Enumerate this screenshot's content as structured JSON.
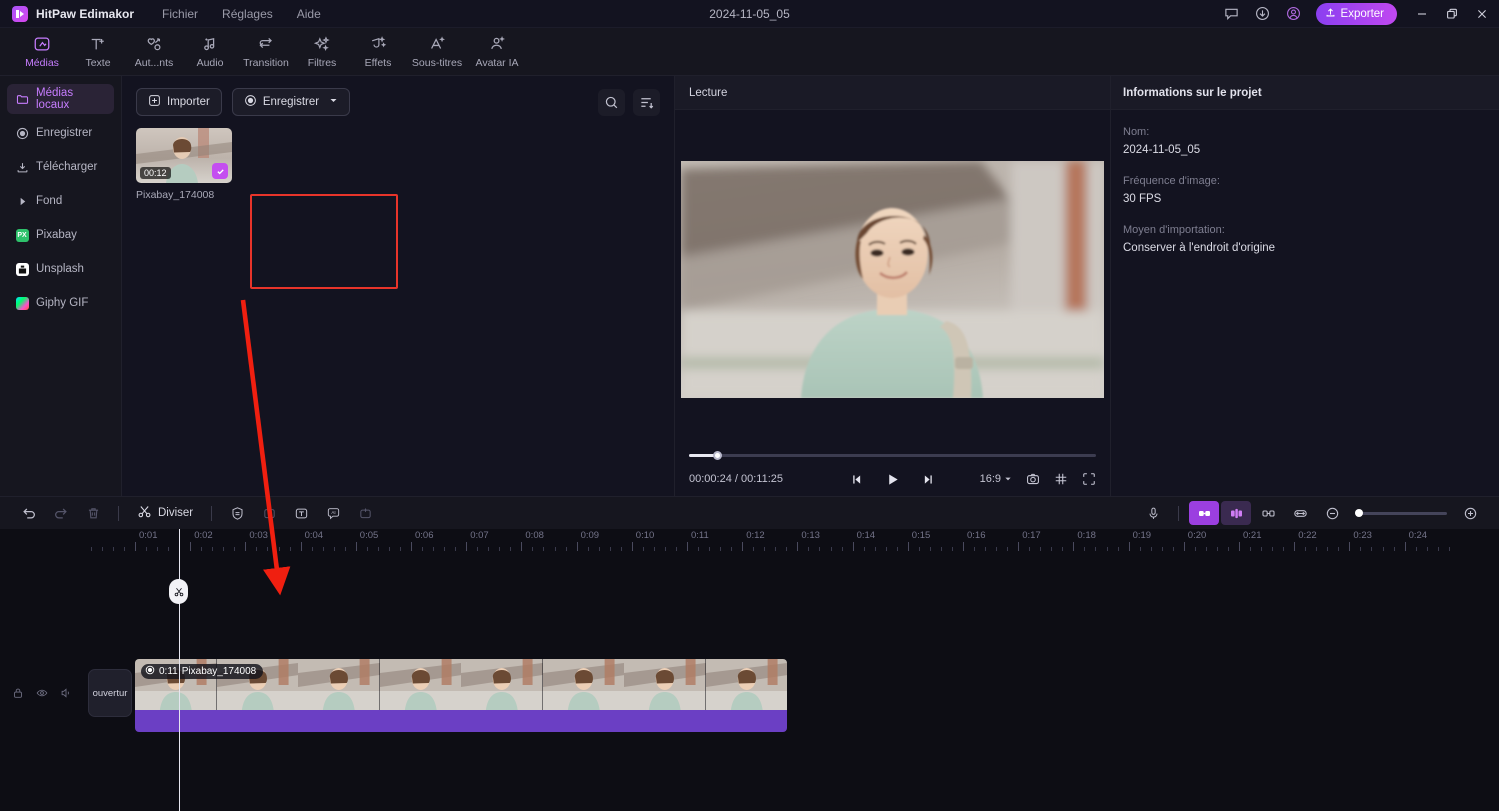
{
  "titlebar": {
    "app_name": "HitPaw Edimakor",
    "menus": [
      "Fichier",
      "Réglages",
      "Aide"
    ],
    "project_title": "2024-11-05_05",
    "export_label": "Exporter",
    "icons": [
      "feedback-icon",
      "download-icon",
      "account-icon"
    ],
    "accent": "#a855f7"
  },
  "tooltabs": [
    {
      "label": "Médias",
      "icon": "media-icon",
      "active": true
    },
    {
      "label": "Texte",
      "icon": "text-icon",
      "active": false
    },
    {
      "label": "Aut...nts",
      "icon": "elements-icon",
      "active": false
    },
    {
      "label": "Audio",
      "icon": "audio-icon",
      "active": false
    },
    {
      "label": "Transition",
      "icon": "transition-icon",
      "active": false
    },
    {
      "label": "Filtres",
      "icon": "filters-icon",
      "active": false
    },
    {
      "label": "Effets",
      "icon": "effects-icon",
      "active": false
    },
    {
      "label": "Sous-titres",
      "icon": "subtitles-icon",
      "active": false
    },
    {
      "label": "Avatar IA",
      "icon": "avatar-icon",
      "active": false
    }
  ],
  "sidebar": [
    {
      "label": "Médias locaux",
      "icon": "folder-icon",
      "active": true
    },
    {
      "label": "Enregistrer",
      "icon": "record-icon",
      "active": false
    },
    {
      "label": "Télécharger",
      "icon": "download-icon",
      "active": false
    },
    {
      "label": "Fond",
      "icon": "chevron-right-icon",
      "active": false
    },
    {
      "label": "Pixabay",
      "icon": "pixabay-icon",
      "brand_color": "#2ec16b",
      "active": false
    },
    {
      "label": "Unsplash",
      "icon": "unsplash-icon",
      "brand_color": "#ffffff",
      "active": false
    },
    {
      "label": "Giphy GIF",
      "icon": "giphy-icon",
      "brand_color": "#ff4ecd",
      "active": false
    }
  ],
  "media_panel": {
    "import_label": "Importer",
    "record_label": "Enregistrer",
    "search_icon": "search-icon",
    "sort_icon": "sort-icon",
    "items": [
      {
        "name": "Pixabay_174008",
        "duration": "00:12",
        "selected": true
      }
    ],
    "selection_outline_color": "#e8342a"
  },
  "preview": {
    "tab_label": "Lecture",
    "current_time": "00:00:24",
    "total_time": "00:11:25",
    "separator": "/",
    "aspect_ratio": "16:9",
    "progress_percent": 7,
    "controls": [
      "step-back-icon",
      "play-icon",
      "step-forward-icon"
    ],
    "right_icons": [
      "snapshot-icon",
      "grid-icon",
      "fullscreen-icon"
    ]
  },
  "project_info": {
    "panel_title": "Informations sur le projet",
    "fields": [
      {
        "label": "Nom:",
        "value": "2024-11-05_05"
      },
      {
        "label": "Fréquence d'image:",
        "value": "30 FPS"
      },
      {
        "label": "Moyen d'importation:",
        "value": "Conserver à l'endroit d'origine"
      }
    ]
  },
  "timeline": {
    "toolbar_left": [
      {
        "name": "undo-icon",
        "state": "enabled"
      },
      {
        "name": "redo-icon",
        "state": "dim"
      },
      {
        "name": "delete-icon",
        "state": "dim"
      }
    ],
    "split_label": "Diviser",
    "split_icon": "scissors-icon",
    "toolbar_mid": [
      {
        "name": "crop-mask-icon",
        "state": "enabled"
      },
      {
        "name": "add-image-icon",
        "state": "dim"
      },
      {
        "name": "add-text-icon",
        "state": "enabled"
      },
      {
        "name": "ai-icon",
        "state": "enabled"
      },
      {
        "name": "add-sticker-icon",
        "state": "dim"
      }
    ],
    "toolbar_right": [
      {
        "name": "microphone-icon",
        "state": "enabled"
      },
      {
        "name": "link-clips-icon",
        "state": "highlight"
      },
      {
        "name": "mix-icon",
        "state": "highlight2"
      },
      {
        "name": "unlink-icon",
        "state": "enabled"
      },
      {
        "name": "fit-icon",
        "state": "enabled"
      }
    ],
    "zoom_out_icon": "zoom-out-icon",
    "zoom_in_icon": "zoom-in-icon",
    "zoom_value": 0,
    "ruler_labels": [
      "0:01",
      "0:02",
      "0:03",
      "0:04",
      "0:05",
      "0:06",
      "0:07",
      "0:08",
      "0:09",
      "0:10",
      "0:11",
      "0:12",
      "0:13",
      "0:14",
      "0:15",
      "0:16",
      "0:17",
      "0:18",
      "0:19",
      "0:20",
      "0:21",
      "0:22",
      "0:23",
      "0:24"
    ],
    "track_header_icons": [
      "lock-icon",
      "eye-icon",
      "mute-icon"
    ],
    "transition_label": "ouvertur",
    "clip": {
      "duration_label": "0:11",
      "name": "Pixabay_174008",
      "badge_icon": "video-icon",
      "audio_color": "#6b3fc4"
    },
    "playhead_icon": "scissors-icon"
  },
  "annotation": {
    "arrow_color": "#f01f10"
  }
}
